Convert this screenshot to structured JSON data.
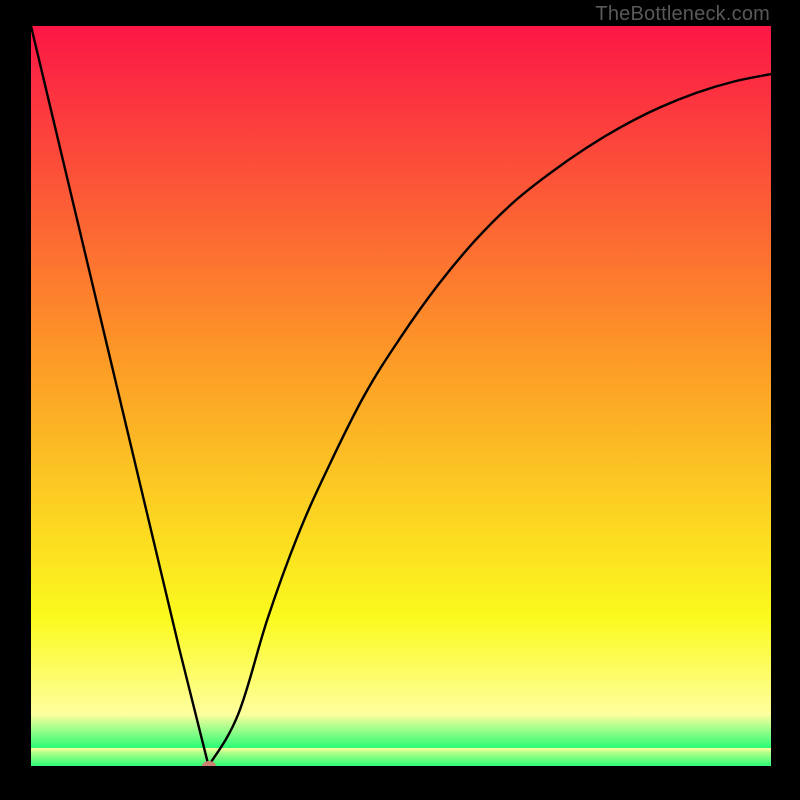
{
  "watermark": "TheBottleneck.com",
  "colors": {
    "black": "#000000",
    "red_top": "#fc1746",
    "orange_mid": "#fd9a27",
    "yellow": "#fbfa1e",
    "pale_yellow": "#feff9e",
    "green": "#2cfc76",
    "marker": "#cd8272",
    "curve": "#000000",
    "watermark": "#58595b"
  },
  "chart_data": {
    "type": "line",
    "title": "",
    "xlabel": "",
    "ylabel": "",
    "xlim": [
      0,
      100
    ],
    "ylim": [
      0,
      100
    ],
    "grid": false,
    "legend": false,
    "series": [
      {
        "name": "bottleneck-curve",
        "x": [
          0,
          5,
          10,
          15,
          20,
          24,
          28,
          32,
          36,
          40,
          45,
          50,
          55,
          60,
          65,
          70,
          75,
          80,
          85,
          90,
          95,
          100
        ],
        "y": [
          100,
          79,
          58,
          37,
          16,
          0,
          7,
          20,
          31,
          40,
          50,
          58,
          65,
          71,
          76,
          80,
          83.5,
          86.5,
          89,
          91,
          92.5,
          93.5
        ]
      }
    ],
    "annotations": [
      {
        "name": "minimum-marker",
        "x": 24,
        "y": 0,
        "shape": "ellipse",
        "color": "#cd8272"
      }
    ],
    "background_gradient": {
      "direction": "vertical",
      "stops": [
        {
          "pos": 0.0,
          "color": "#fc1746"
        },
        {
          "pos": 0.45,
          "color": "#fd9a27"
        },
        {
          "pos": 0.8,
          "color": "#fbfa1e"
        },
        {
          "pos": 0.93,
          "color": "#feff9e"
        },
        {
          "pos": 0.975,
          "color": "#2cfc76"
        },
        {
          "pos": 1.0,
          "color": "#2cfc76"
        }
      ]
    }
  }
}
